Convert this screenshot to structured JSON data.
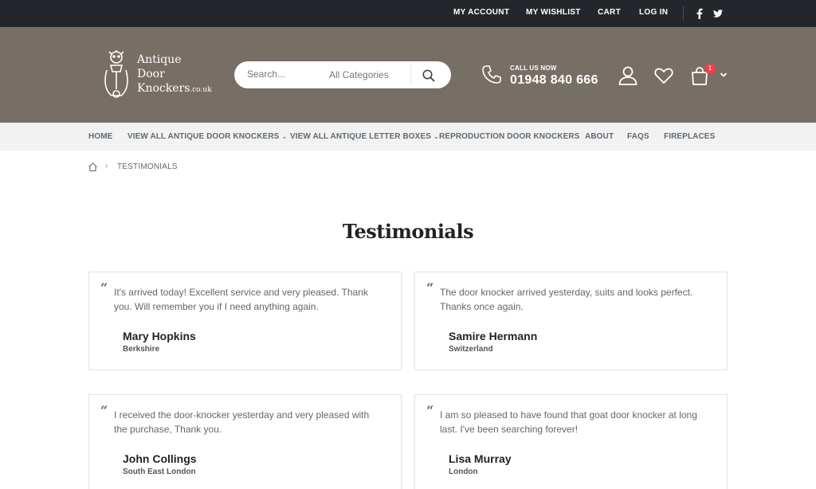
{
  "topbar": {
    "links": [
      "MY ACCOUNT",
      "MY WISHLIST",
      "CART",
      "LOG IN"
    ],
    "social": [
      "facebook-icon",
      "twitter-icon"
    ],
    "background": "#23272b"
  },
  "header": {
    "background": "#776e66",
    "logo": {
      "line1": "Antique",
      "line2": "Door",
      "line3": "Knockers",
      "tld": ".co.uk"
    },
    "search": {
      "placeholder": "Search...",
      "category": "All Categories"
    },
    "call_label": "CALL US NOW",
    "phone": "01948 840 666",
    "cart_count": "1"
  },
  "nav": {
    "items": [
      "HOME",
      "VIEW ALL ANTIQUE DOOR KNOCKERS",
      "VIEW ALL ANTIQUE LETTER BOXES",
      "REPRODUCTION DOOR KNOCKERS",
      "ABOUT",
      "FAQS",
      "FIREPLACES"
    ]
  },
  "breadcrumb": {
    "current": "TESTIMONIALS"
  },
  "page": {
    "title": "Testimonials"
  },
  "testimonials": [
    {
      "text": "It's arrived today! Excellent service and very pleased. Thank you. Will remember you if I need anything again.",
      "name": "Mary Hopkins",
      "location": "Berkshire"
    },
    {
      "text": "The door knocker arrived yesterday, suits and looks perfect. Thanks once again.",
      "name": "Samire Hermann",
      "location": "Switzerland"
    },
    {
      "text": "I received the door-knocker yesterday and very pleased with the purchase, Thank you.",
      "name": "John Collings",
      "location": "South East London"
    },
    {
      "text": "I am so pleased to have found that goat door knocker at long last.  I've been searching forever!",
      "name": "Lisa Murray",
      "location": "London"
    }
  ]
}
